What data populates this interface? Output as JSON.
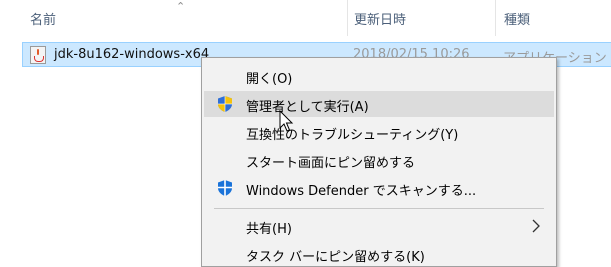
{
  "header": {
    "col_name": "名前",
    "col_date": "更新日時",
    "col_type": "種類",
    "sort_indicator": "^"
  },
  "file_row": {
    "name": "jdk-8u162-windows-x64",
    "date": "2018/02/15 10:26",
    "type": "アプリケーション",
    "icon": "java-installer-icon"
  },
  "context_menu": {
    "items": [
      {
        "label": "開く(O)"
      },
      {
        "label": "管理者として実行(A)",
        "icon": "uac-shield-icon",
        "highlighted": true
      },
      {
        "label": "互換性のトラブルシューティング(Y)"
      },
      {
        "label": "スタート画面にピン留めする"
      },
      {
        "label": "Windows Defender でスキャンする...",
        "icon": "windows-defender-icon"
      },
      {
        "label": "共有(H)",
        "submenu": true
      },
      {
        "label": "タスク バーにピン留めする(K)"
      }
    ]
  },
  "colors": {
    "selection_bg": "#cce8ff",
    "selection_border": "#99d1ff",
    "menu_bg": "#f2f2f2",
    "menu_highlight": "#dcdcdc",
    "header_text": "#4c607a",
    "defender_blue": "#1a73d9"
  }
}
